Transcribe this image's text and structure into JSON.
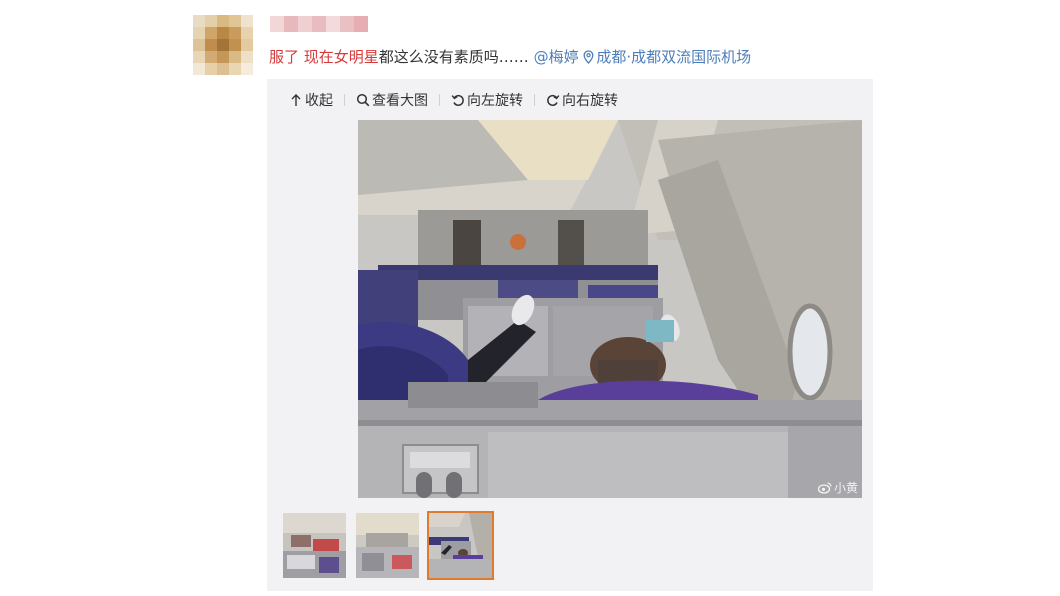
{
  "post": {
    "text_red": "服了 现在女明星",
    "text_plain": "都这么没有素质吗……",
    "mention": "@梅婷",
    "location": "成都·成都双流国际机场",
    "location_icon": "pin-icon"
  },
  "toolbar": {
    "items": [
      {
        "icon": "arrow-up-icon",
        "label": "收起"
      },
      {
        "icon": "magnifier-icon",
        "label": "查看大图"
      },
      {
        "icon": "rotate-left-icon",
        "label": "向左旋转"
      },
      {
        "icon": "rotate-right-icon",
        "label": "向右旋转"
      }
    ]
  },
  "photo": {
    "subject": "airplane cabin interior with passenger feet on seat back",
    "watermark": "小黄",
    "watermark_icon": "weibo-icon"
  },
  "thumbnails": {
    "count": 3,
    "active_index": 2
  },
  "colors": {
    "accent_red": "#d63a3a",
    "link_blue": "#4e7eb8",
    "active_border": "#e07a2c",
    "panel_bg": "#f2f2f5"
  }
}
